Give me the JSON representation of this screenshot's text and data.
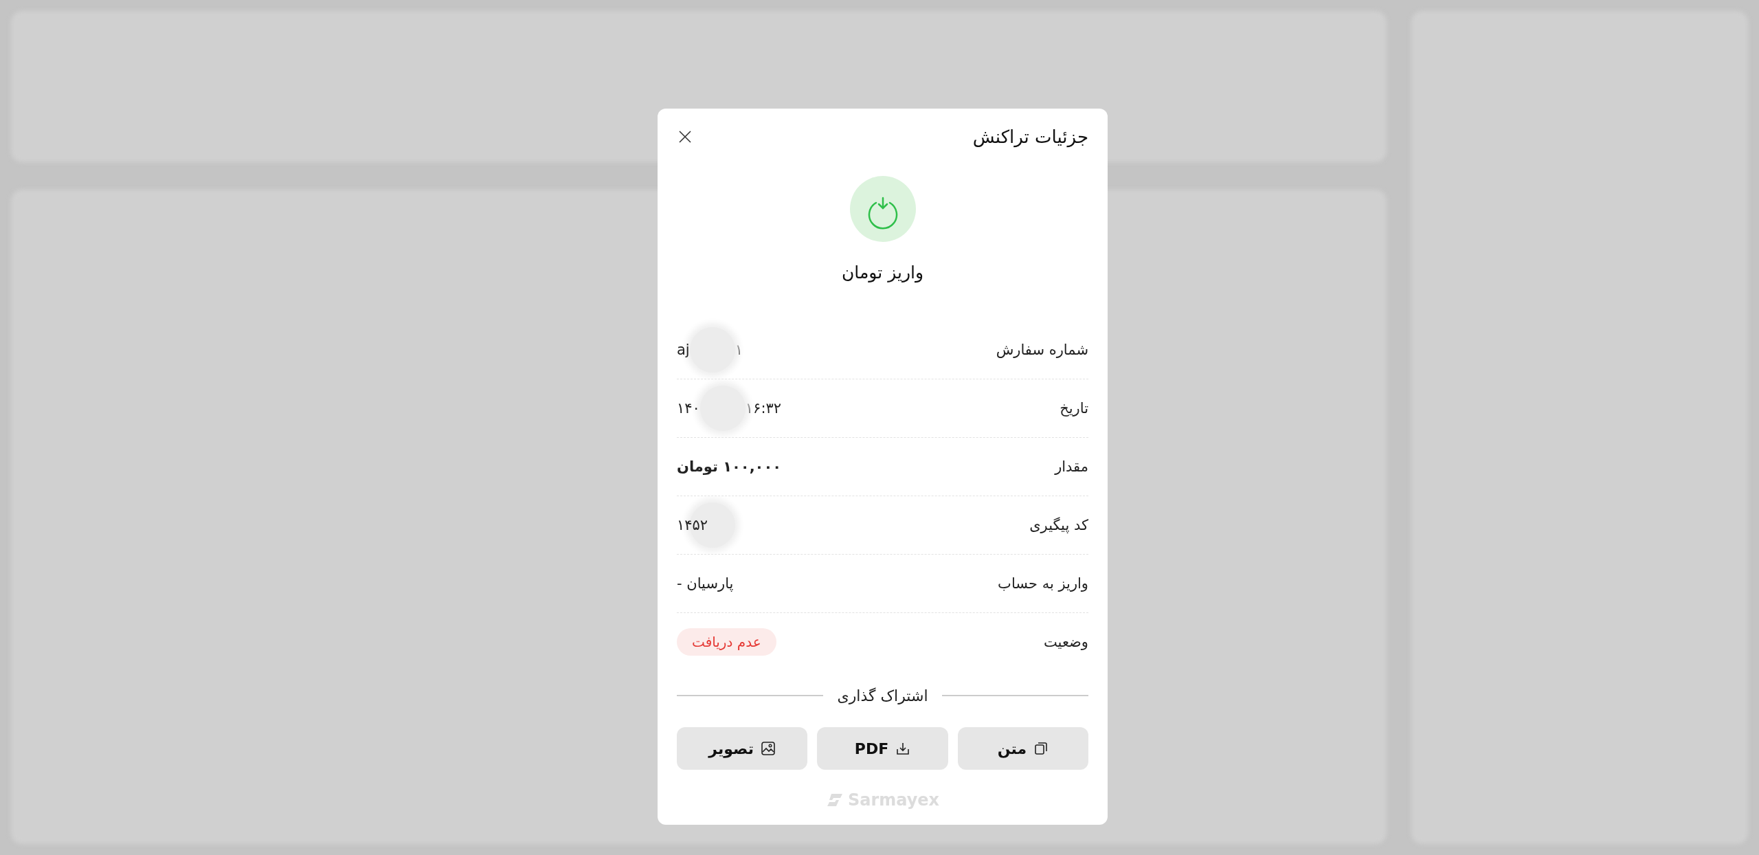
{
  "dialog": {
    "title": "جزئیات تراکنش",
    "type_label": "واریز تومان",
    "rows": [
      {
        "label": "شماره سفارش",
        "kind": "masked",
        "value_parts": [
          "۱",
          "aj"
        ]
      },
      {
        "label": "تاریخ",
        "kind": "masked",
        "value_parts": [
          "۱۶:۳۲",
          "۱۴۰"
        ]
      },
      {
        "label": "مقدار",
        "kind": "plain",
        "value": "۱۰۰,۰۰۰ تومان"
      },
      {
        "label": "کد پیگیری",
        "kind": "masked_tail",
        "value": "۱۴۵۲"
      },
      {
        "label": "واریز به حساب",
        "kind": "plain",
        "value": "پارسیان -"
      },
      {
        "label": "وضعیت",
        "kind": "status",
        "value": "عدم دریافت",
        "color": "#e53935"
      }
    ],
    "share_title": "اشتراک گذاری",
    "share_buttons": [
      {
        "label": "متن",
        "kind": "copy"
      },
      {
        "label": "PDF",
        "kind": "download"
      },
      {
        "label": "تصویر",
        "kind": "image"
      }
    ],
    "brand": "Sarmayex"
  }
}
